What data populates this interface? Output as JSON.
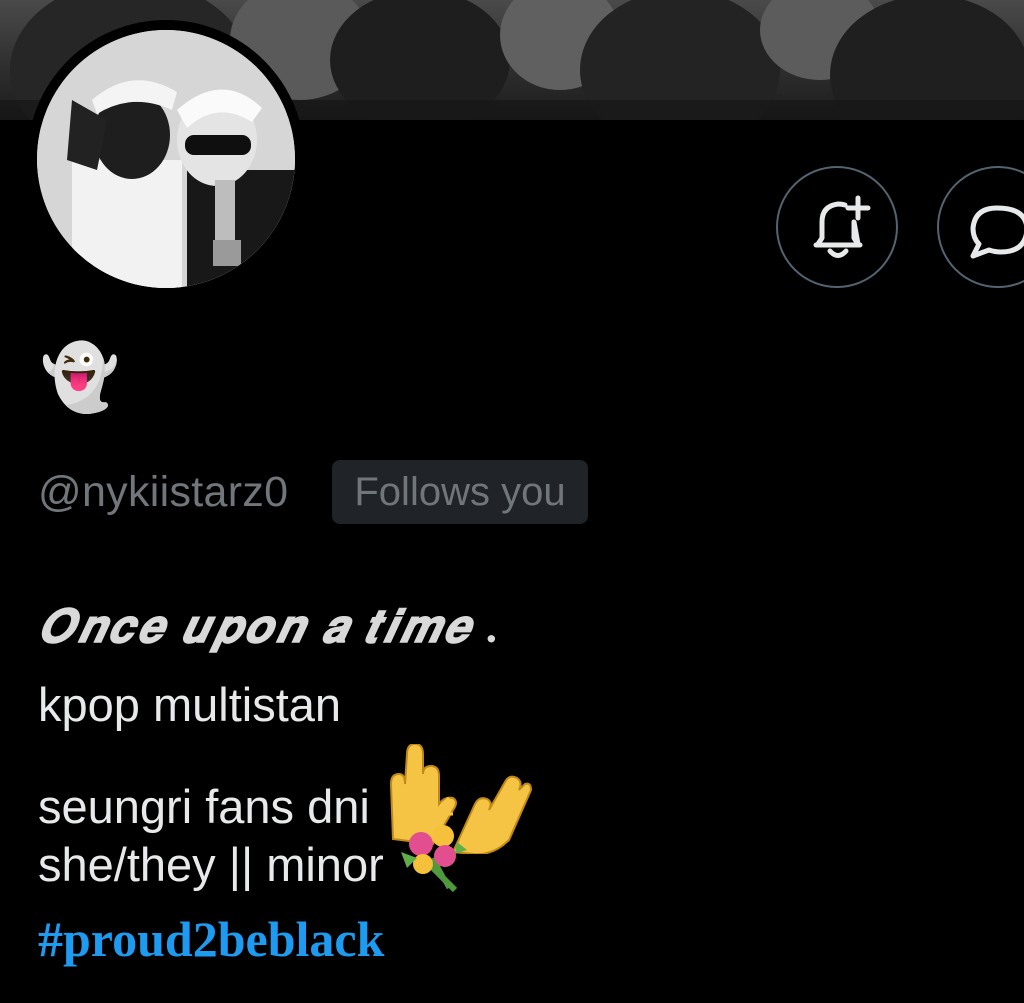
{
  "profile": {
    "display_name": "👻",
    "handle": "@nykiistarz0",
    "follows_badge": "Follows you"
  },
  "bio": {
    "line1": "𝑶𝒏𝒄𝒆 𝒖𝒑𝒐𝒏 𝒂 𝒕𝒊𝒎𝒆 .",
    "line2": "kpop multistan",
    "line3": "seungri fans dni",
    "line4": "she/they || minor",
    "hashtag": "#proud2beblack"
  },
  "icons": {
    "notify": "bell-plus-icon",
    "message": "message-bubble-icon",
    "waving_hands": "waving-hands-emoji",
    "bouquet": "bouquet-emoji"
  },
  "colors": {
    "background": "#000000",
    "text_primary": "#e7e9ea",
    "text_secondary": "#71767b",
    "badge_bg": "#202327",
    "button_border": "#536471",
    "link": "#1d9bf0"
  }
}
